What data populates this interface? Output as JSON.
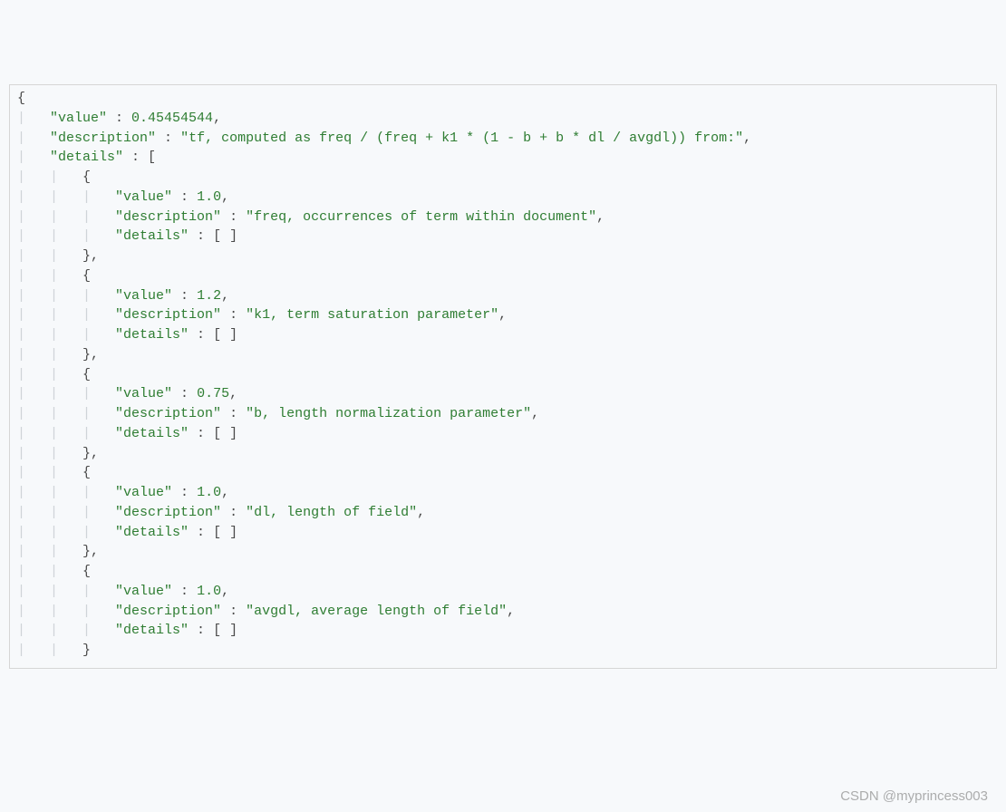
{
  "root": {
    "value_key": "\"value\"",
    "value_value": "0.45454544",
    "description_key": "\"description\"",
    "description_value": "\"tf, computed as freq / (freq + k1 * (1 - b + b * dl / avgdl)) from:\"",
    "details_key": "\"details\""
  },
  "details": [
    {
      "value_key": "\"value\"",
      "value_value": "1.0",
      "description_key": "\"description\"",
      "description_value": "\"freq, occurrences of term within document\"",
      "details_key": "\"details\"",
      "details_value": "[ ]"
    },
    {
      "value_key": "\"value\"",
      "value_value": "1.2",
      "description_key": "\"description\"",
      "description_value": "\"k1, term saturation parameter\"",
      "details_key": "\"details\"",
      "details_value": "[ ]"
    },
    {
      "value_key": "\"value\"",
      "value_value": "0.75",
      "description_key": "\"description\"",
      "description_value": "\"b, length normalization parameter\"",
      "details_key": "\"details\"",
      "details_value": "[ ]"
    },
    {
      "value_key": "\"value\"",
      "value_value": "1.0",
      "description_key": "\"description\"",
      "description_value": "\"dl, length of field\"",
      "details_key": "\"details\"",
      "details_value": "[ ]"
    },
    {
      "value_key": "\"value\"",
      "value_value": "1.0",
      "description_key": "\"description\"",
      "description_value": "\"avgdl, average length of field\"",
      "details_key": "\"details\"",
      "details_value": "[ ]"
    }
  ],
  "watermark": "CSDN @myprincess003"
}
